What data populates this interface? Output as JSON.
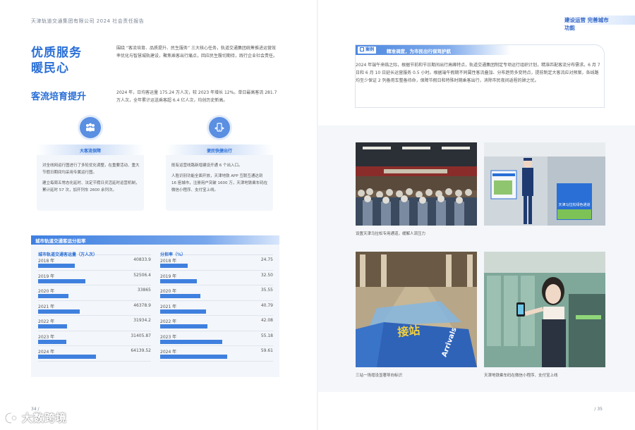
{
  "header": {
    "report_title": "天津轨道交通集团有限公司 2024 社会责任报告",
    "section_badge": "建设运营 完善城市功能"
  },
  "left": {
    "title_line1": "优质服务",
    "title_line2": "暖民心",
    "intro": "围绕 “客流培育、品质提升、民生服务” 三大核心任务，轨道交通集团统筹推进运营效率优化与智慧城轨建设，聚焦乘客出行痛点，回应民生殷切期待，践行企业社会责任。",
    "subtitle": "客流培育提升",
    "kpi_text": "2024 年，日均客运量 175.24 万人次，较 2023 年增长 12%。单日最高客流 281.7 万人次，全年累计运送乘客超 6.4 亿人次，均创历史新高。",
    "cards": [
      {
        "title": "大客流保障",
        "paragraphs": [
          "对全线网运行图进行了多轮优化调整，在重要活动、重大节假日期间均采用专属运行图。",
          "建立每周五常态化延时、法定节假日灵活延时运营机制，累计延时 57 次，加开列车 2600 余列次。"
        ]
      },
      {
        "title": "便民快捷出行",
        "paragraphs": [
          "既有运营线路新增建设开通 6 个出入口。",
          "人脸识别功能全面开放，天津地铁 APP 互联互通达到 16 座城市，注册用户突破 1600 万，天津地铁乘车码在微信小程序、支付宝上线。"
        ]
      }
    ],
    "table": {
      "title": "城市轨道交通客运分担率",
      "col1_header": "城市轨道交通客运量（万人次）",
      "col2_header": "分担率（%）",
      "ridership": [
        {
          "year": "2018 年",
          "value": "40833.9",
          "num": 40833.9
        },
        {
          "year": "2019 年",
          "value": "52506.4",
          "num": 52506.4
        },
        {
          "year": "2020 年",
          "value": "33865",
          "num": 33865
        },
        {
          "year": "2021 年",
          "value": "46378.9",
          "num": 46378.9
        },
        {
          "year": "2022 年",
          "value": "31934.2",
          "num": 31934.2
        },
        {
          "year": "2023 年",
          "value": "31405.87",
          "num": 31405.87
        },
        {
          "year": "2024 年",
          "value": "64139.52",
          "num": 64139.52
        }
      ],
      "share": [
        {
          "year": "2018 年",
          "value": "24.75",
          "num": 24.75
        },
        {
          "year": "2019 年",
          "value": "32.50",
          "num": 32.5
        },
        {
          "year": "2020 年",
          "value": "35.55",
          "num": 35.55
        },
        {
          "year": "2021 年",
          "value": "40.79",
          "num": 40.79
        },
        {
          "year": "2022 年",
          "value": "42.08",
          "num": 42.08
        },
        {
          "year": "2023 年",
          "value": "55.18",
          "num": 55.18
        },
        {
          "year": "2024 年",
          "value": "59.61",
          "num": 59.61
        }
      ]
    },
    "page_number": "34 /"
  },
  "right": {
    "case_tag": "案例",
    "case_title": "精准调度，为市民出行保驾护航",
    "case_body": "2024 年端午来临之际，根据节前和节日期间出行高峰特点，轨道交通集团制定专项运行组织计划，精准匹配客流分布需求。6 月 7 日和 6 月 10 日延长运营服务 0.5 小时。根据端午假期不同属性客流叠加、分布趋势多变特点，提前制定大客流应对预案，各线路均至少保证 2 列备用车整备待命，保障节假日和特殊时期乘客出行，消除市民夜间返程的顾之忧。",
    "captions": [
      "设置天津马拉松专用通道，缓解人流压力",
      "",
      "三站一场增设显著导向标识",
      "天津地铁乘车码在微信小程序、支付宝上线"
    ],
    "sign_text": "天津马拉松绿色通道",
    "floor_text_cn": "接站",
    "floor_text_en": "Arrivals",
    "page_number": "/ 35"
  },
  "watermark": "大数跨境",
  "colors": {
    "accent": "#2a6fd6",
    "bar": "#3f80df",
    "panel": "#f3f6fa"
  }
}
